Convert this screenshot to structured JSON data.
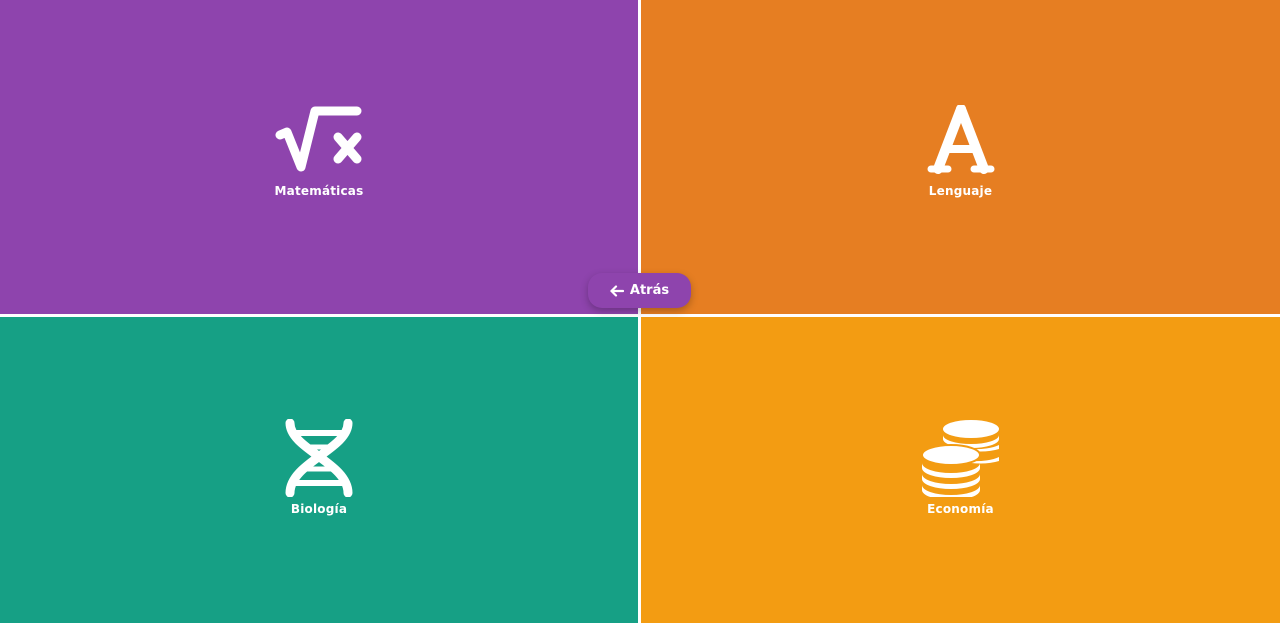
{
  "tiles": [
    {
      "id": "matematicas",
      "label": "Matemáticas",
      "color": "#8e44ad",
      "icon": "square-root-x-icon"
    },
    {
      "id": "lenguaje",
      "label": "Lenguaje",
      "color": "#e67e22",
      "icon": "letter-a-icon"
    },
    {
      "id": "biologia",
      "label": "Biología",
      "color": "#16a085",
      "icon": "dna-icon"
    },
    {
      "id": "economia",
      "label": "Economía",
      "color": "#f39c12",
      "icon": "coins-icon"
    }
  ],
  "back_button": {
    "label": "Atrás",
    "icon": "arrow-left-icon",
    "color": "#8e44ad"
  },
  "divider_color": "#ffffff"
}
